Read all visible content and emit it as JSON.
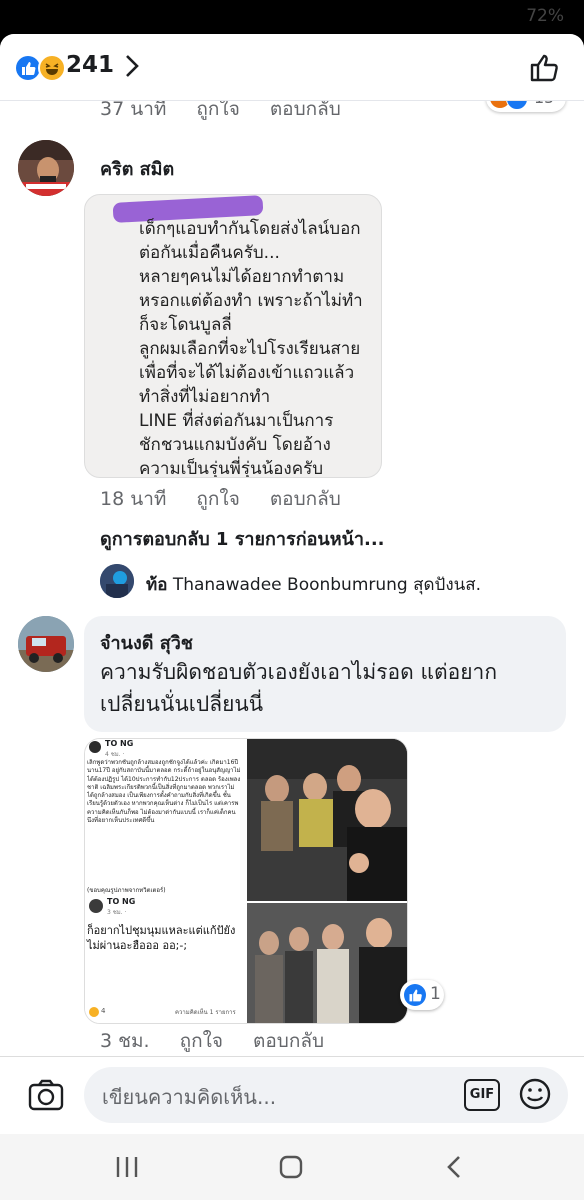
{
  "status": {
    "battery": "72%"
  },
  "header": {
    "reaction_count": "241",
    "reactions": [
      "like-icon",
      "haha-icon"
    ]
  },
  "prev": {
    "time": "37 นาที",
    "like": "ถูกใจ",
    "reply": "ตอบกลับ",
    "reaction_count": "15"
  },
  "comment1": {
    "name": "คริต สมิต",
    "screenshot_header": "...",
    "screenshot_lines": [
      "เด็กๆแอบทำกันโดยส่งไลน์บอก",
      "ต่อกันเมื่อคืนครับ...",
      "หลายๆคนไม่ได้อยากทำตาม",
      "หรอกแต่ต้องทำ เพราะถ้าไม่ทำ",
      "ก็จะโดนบูลลี่",
      "ลูกผมเลือกที่จะไปโรงเรียนสาย",
      "เพื่อที่จะได้ไม่ต้องเข้าแถวแล้ว",
      "ทำสิ่งที่ไม่อยากทำ",
      "LINE ที่ส่งต่อกันมาเป็นการ",
      "ชักชวนแกมบังคับ โดยอ้าง",
      "ความเป็นรุ่นพี่รุ่นน้องครับ"
    ],
    "time": "18 นาที",
    "like": "ถูกใจ",
    "reply": "ตอบกลับ"
  },
  "view_previous": "ดูการตอบกลับ 1 รายการก่อนหน้า...",
  "reply_preview": {
    "name": "ท้อ",
    "text": "Thanawadee Boonbumrung สุดปังนส."
  },
  "comment2": {
    "name": "จำนงดี สุวิช",
    "text": "ความรับผิดชอบตัวเองยังเอาไม่รอด แต่อยากเปลี่ยนนั่นเปลี่ยนนี่",
    "meme": {
      "post_author": "TO NG",
      "post_time": "4 ชม. ·",
      "post_body": "เลิกพูดว่าพวกชั้นถูกล้างสมองถูกชักจูงได้แล้วค่ะ เกิดมา16ปีนาน17ปี อยู่กับสถาบันนี้มาตลอด กระดี้ถ้าอยู่ในอนุสัญญาไม่ได้ต้องปฏิรูป ได้10ประการทำกับ12ประการ ตลอด ร้องเพลงชาติ เฉลิมพระเกียรติพวกนี้เป็นสิ่งที่ถูกมาตลอด พวกเราไม่ได้ถูกล้างสมอง เป็นเพียงการตั้งคำถามกับสิ่งที่เกิดขึ้น ชั้นเรียนรู้ด้วยตัวเอง หากพวกคุณเห็นต่าง ก็ไม่เป็นไร แต่เคารพความคิดเห็นกันก็พอ ไม่ต้องมาด่ากันแบบนี้ เราก็แค่เด็กคนนึงที่อยากเห็นประเทศดีขึ้น",
      "post_footer": "(ขอบคุณรูปภาพจากทวิตเตอร์)",
      "reply_author": "TO NG",
      "reply_time": "3 ชม. ·",
      "reply_text": "ก็อยากไปชุมนุมแหละแต่แก้ปัยังไม่ผ่านอะฮือออ ออ;-;",
      "reply_footer": "ความคิดเห็น 1 รายการ",
      "reply_like_count": "4"
    },
    "reaction_count": "1",
    "time": "3 ชม.",
    "like": "ถูกใจ",
    "reply": "ตอบกลับ"
  },
  "composer": {
    "placeholder": "เขียนความคิดเห็น...",
    "gif": "GIF"
  },
  "colors": {
    "accent": "#1877f2",
    "bubble": "#f0f2f5",
    "meta": "#65676b"
  }
}
